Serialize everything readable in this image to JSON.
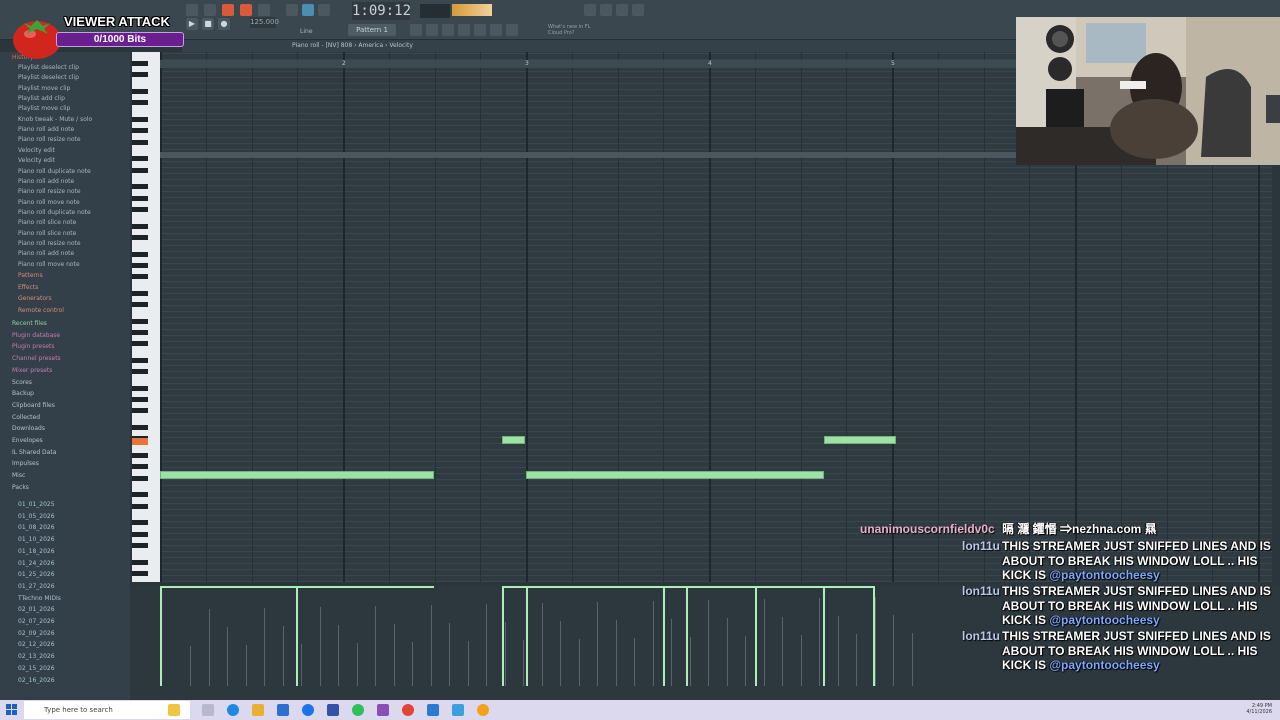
{
  "overlay": {
    "title": "VIEWER ATTACK",
    "bits": "0/1000 Bits"
  },
  "toolbar": {
    "time": "1:09:12",
    "pattern": "Pattern 1",
    "tempo": "125.000",
    "news_line1": "What's new in FL",
    "news_line2": "Cloud Pro?",
    "mode": "Line"
  },
  "piano_roll": {
    "breadcrumb": "Piano roll - [NV] 808 › America › Velocity",
    "bar_numbers": [
      "2",
      "3",
      "4",
      "5"
    ]
  },
  "browser": {
    "history_header": "History",
    "history": [
      "Playlist deselect clip",
      "Playlist deselect clip",
      "Playlist move clip",
      "Playlist add clip",
      "Playlist move clip",
      "Knob tweak - Mute / solo",
      "Piano roll add note",
      "Piano roll resize note",
      "Velocity edit",
      "Velocity edit",
      "Piano roll duplicate note",
      "Piano roll add note",
      "Piano roll resize note",
      "Piano roll move note",
      "Piano roll duplicate note",
      "Piano roll slice note",
      "Piano roll slice note",
      "Piano roll resize note",
      "Piano roll add note",
      "Piano roll move note"
    ],
    "sections": [
      "Patterns",
      "Effects",
      "Generators",
      "Remote control"
    ],
    "folders": [
      "Recent files",
      "Plugin database",
      "Plugin presets",
      "Channel presets",
      "Mixer presets",
      "Scores",
      "Backup",
      "Clipboard files",
      "Collected",
      "Downloads",
      "Envelopes",
      "IL Shared Data",
      "Impulses",
      "Misc",
      "Packs"
    ],
    "packs": [
      "01_01_2025",
      "01_05_2026",
      "01_08_2026",
      "01_10_2026",
      "01_18_2026",
      "01_24_2026",
      "01_25_2026",
      "01_27_2026",
      "TTechno MIDIs",
      "02_01_2026",
      "02_07_2026",
      "02_09_2026",
      "02_12_2026",
      "02_13_2026",
      "02_15_2026",
      "02_16_2026"
    ]
  },
  "chat": [
    {
      "user": "unanimouscornfieldv0c",
      "text": "㬏 㶏 鑺惽 ⇒nezhna.com 㬎",
      "mention": ""
    },
    {
      "user": "lon11u",
      "text": "THIS STREAMER JUST SNIFFED LINES AND IS ABOUT TO BREAK HIS WINDOW LOLL .. HIS KICK IS ",
      "mention": "@paytontoocheesy"
    },
    {
      "user": "lon11u",
      "text": "THIS STREAMER JUST SNIFFED LINES AND IS ABOUT TO BREAK HIS WINDOW LOLL .. HIS KICK IS ",
      "mention": "@paytontoocheesy"
    },
    {
      "user": "lon11u",
      "text": "THIS STREAMER JUST SNIFFED LINES AND IS ABOUT TO BREAK HIS WINDOW LOLL .. HIS KICK IS ",
      "mention": "@paytontoocheesy"
    }
  ],
  "taskbar": {
    "search_placeholder": "Type here to search",
    "time": "2:49 PM",
    "date": "4/11/2026"
  },
  "colors": {
    "note": "#9fe0a6",
    "overlay_bar": "#6a1f8f",
    "mention": "#7fa8ff"
  }
}
